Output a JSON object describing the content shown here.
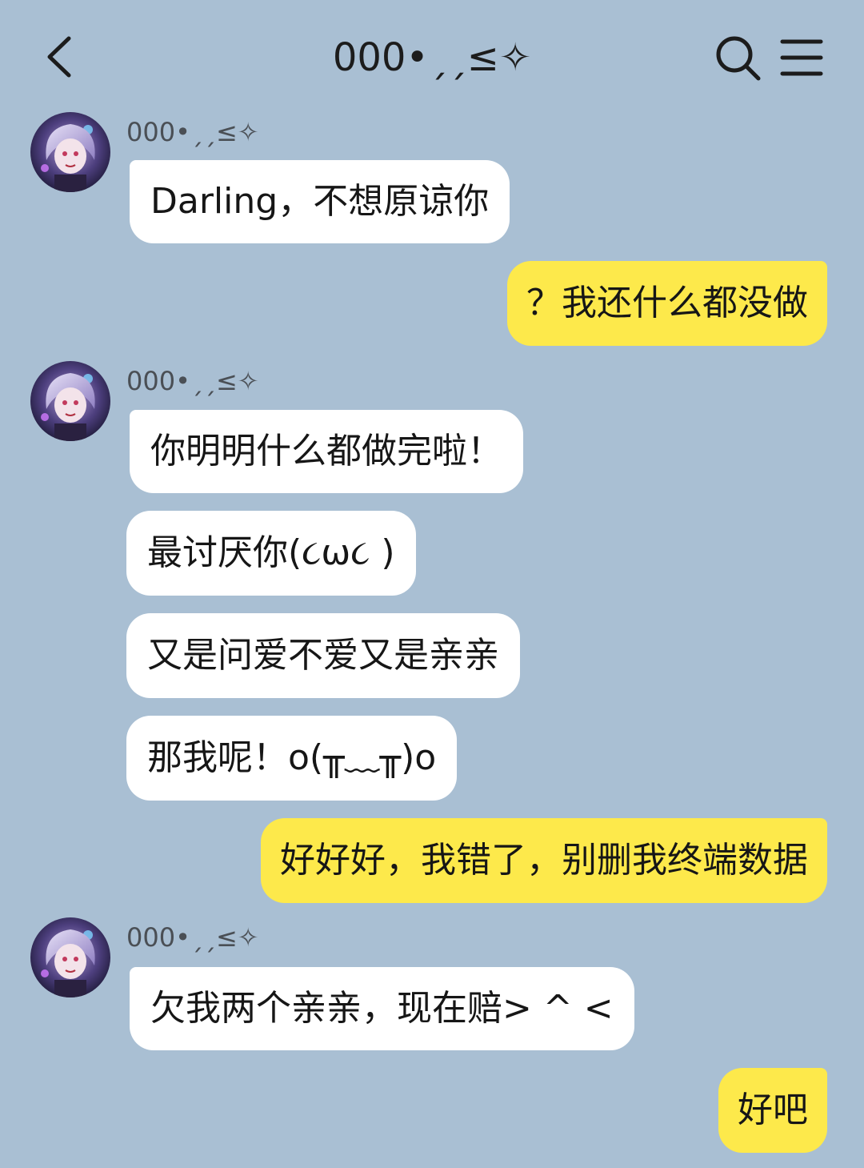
{
  "header": {
    "title": "000•ˏˏ≤✧"
  },
  "messages": [
    {
      "sender": "000•ˏˏ≤✧",
      "text": "Darling，不想原谅你"
    },
    {
      "text": "？我还什么都没做"
    },
    {
      "sender": "000•ˏˏ≤✧",
      "text": "你明明什么都做完啦！"
    },
    {
      "text": "最讨厌你(૮ω૮ )"
    },
    {
      "text": "又是问爱不爱又是亲亲"
    },
    {
      "text": "那我呢！o(╥﹏╥)o"
    },
    {
      "text": "好好好，我错了，别删我终端数据"
    },
    {
      "sender": "000•ˏˏ≤✧",
      "text": "欠我两个亲亲，现在赔> ^ <"
    },
    {
      "text": "好吧"
    }
  ],
  "colors": {
    "background": "#a9bfd3",
    "incoming_bubble": "#ffffff",
    "outgoing_bubble": "#fde94b"
  },
  "icons": {
    "back": "chevron-left-icon",
    "search": "search-icon",
    "menu": "hamburger-menu-icon"
  }
}
